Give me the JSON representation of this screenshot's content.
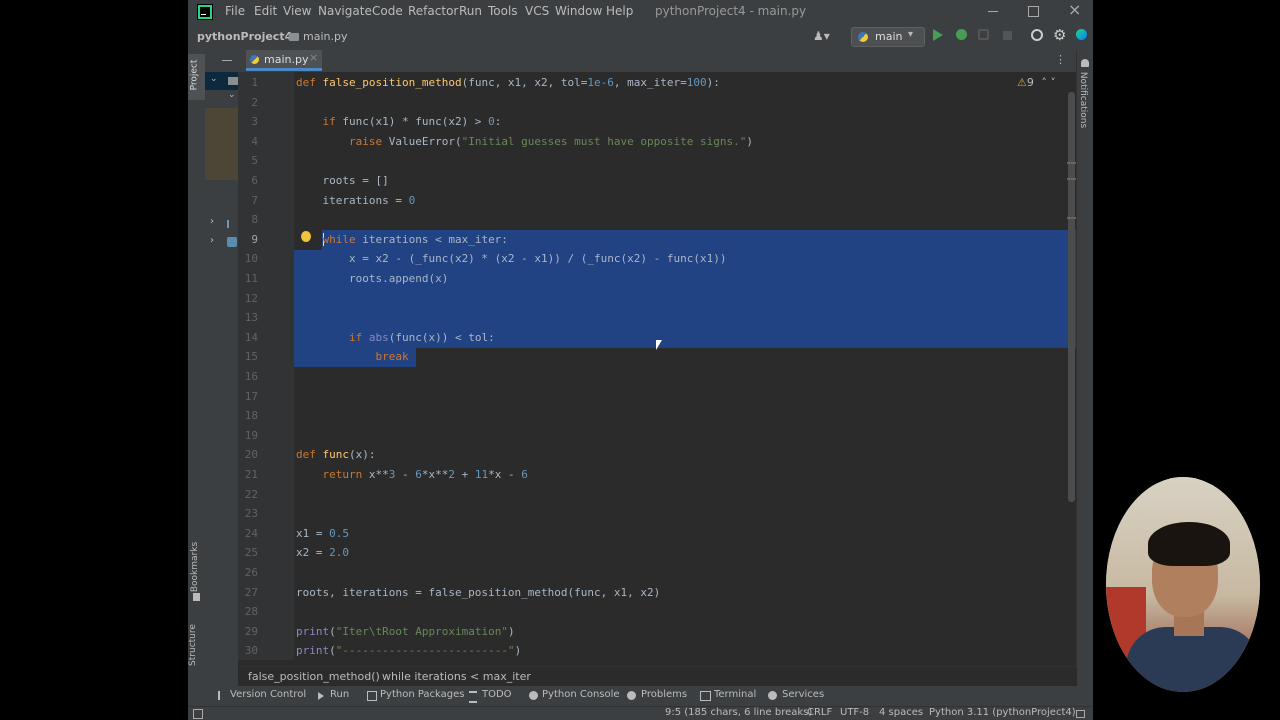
{
  "window": {
    "title": "pythonProject4 - main.py",
    "menu": [
      "File",
      "Edit",
      "View",
      "Navigate",
      "Code",
      "Refactor",
      "Run",
      "Tools",
      "VCS",
      "Window",
      "Help"
    ]
  },
  "nav": {
    "project": "pythonProject4",
    "file": "main.py",
    "run_config": "main"
  },
  "tab": {
    "label": "main.py"
  },
  "inspection": {
    "count": "9"
  },
  "side_tools": {
    "project": "Project",
    "bookmarks": "Bookmarks",
    "structure": "Structure",
    "notifications": "Notifications"
  },
  "code": {
    "line_numbers": [
      "1",
      "2",
      "3",
      "4",
      "5",
      "6",
      "7",
      "8",
      "9",
      "10",
      "11",
      "12",
      "13",
      "14",
      "15",
      "16",
      "17",
      "18",
      "19",
      "20",
      "21",
      "22",
      "23",
      "24",
      "25",
      "26",
      "27",
      "28",
      "29",
      "30"
    ],
    "lines": [
      [
        {
          "t": "def ",
          "c": "#cc7832"
        },
        {
          "t": "false_position_method",
          "c": "#ffc66d"
        },
        {
          "t": "(func, x1, x2, tol=",
          "c": "#a9b7c6"
        },
        {
          "t": "1e-6",
          "c": "#6897bb"
        },
        {
          "t": ", max_iter=",
          "c": "#a9b7c6"
        },
        {
          "t": "100",
          "c": "#6897bb"
        },
        {
          "t": "):",
          "c": "#a9b7c6"
        }
      ],
      [],
      [
        {
          "t": "    if ",
          "c": "#cc7832"
        },
        {
          "t": "func(x1) * func(x2) > ",
          "c": "#a9b7c6"
        },
        {
          "t": "0",
          "c": "#6897bb"
        },
        {
          "t": ":",
          "c": "#a9b7c6"
        }
      ],
      [
        {
          "t": "        raise ",
          "c": "#cc7832"
        },
        {
          "t": "ValueError(",
          "c": "#a9b7c6"
        },
        {
          "t": "\"Initial guesses must have opposite signs.\"",
          "c": "#6a8759"
        },
        {
          "t": ")",
          "c": "#a9b7c6"
        }
      ],
      [],
      [
        {
          "t": "    roots = []",
          "c": "#a9b7c6"
        }
      ],
      [
        {
          "t": "    iterations = ",
          "c": "#a9b7c6"
        },
        {
          "t": "0",
          "c": "#6897bb"
        }
      ],
      [],
      [
        {
          "t": "    while ",
          "c": "#cc7832"
        },
        {
          "t": "iterations < max_iter:",
          "c": "#a9b7c6"
        }
      ],
      [
        {
          "t": "        x = x2 - (_func(x2) * (x2 - x1)) / (_func(x2) - func(x1))",
          "c": "#a9b7c6"
        }
      ],
      [
        {
          "t": "        roots.append(x)",
          "c": "#a9b7c6"
        }
      ],
      [],
      [],
      [
        {
          "t": "        if ",
          "c": "#cc7832"
        },
        {
          "t": "abs",
          "c": "#8888c6"
        },
        {
          "t": "(func(x)) < tol:",
          "c": "#a9b7c6"
        }
      ],
      [
        {
          "t": "            break",
          "c": "#cc7832"
        }
      ],
      [],
      [],
      [],
      [],
      [
        {
          "t": "def ",
          "c": "#cc7832"
        },
        {
          "t": "func",
          "c": "#ffc66d"
        },
        {
          "t": "(x):",
          "c": "#a9b7c6"
        }
      ],
      [
        {
          "t": "    return ",
          "c": "#cc7832"
        },
        {
          "t": "x**",
          "c": "#a9b7c6"
        },
        {
          "t": "3 ",
          "c": "#6897bb"
        },
        {
          "t": "- ",
          "c": "#a9b7c6"
        },
        {
          "t": "6",
          "c": "#6897bb"
        },
        {
          "t": "*x**",
          "c": "#a9b7c6"
        },
        {
          "t": "2 ",
          "c": "#6897bb"
        },
        {
          "t": "+ ",
          "c": "#a9b7c6"
        },
        {
          "t": "11",
          "c": "#6897bb"
        },
        {
          "t": "*x - ",
          "c": "#a9b7c6"
        },
        {
          "t": "6",
          "c": "#6897bb"
        }
      ],
      [],
      [],
      [
        {
          "t": "x1 = ",
          "c": "#a9b7c6"
        },
        {
          "t": "0.5",
          "c": "#6897bb"
        }
      ],
      [
        {
          "t": "x2 = ",
          "c": "#a9b7c6"
        },
        {
          "t": "2.0",
          "c": "#6897bb"
        }
      ],
      [],
      [
        {
          "t": "roots, iterations = false_position_method(func, x1, x2)",
          "c": "#a9b7c6"
        }
      ],
      [],
      [
        {
          "t": "print",
          "c": "#8888c6"
        },
        {
          "t": "(",
          "c": "#a9b7c6"
        },
        {
          "t": "\"Iter\\tRoot Approximation\"",
          "c": "#6a8759"
        },
        {
          "t": ")",
          "c": "#a9b7c6"
        }
      ],
      [
        {
          "t": "print",
          "c": "#8888c6"
        },
        {
          "t": "(",
          "c": "#a9b7c6"
        },
        {
          "t": "\"-------------------------\"",
          "c": "#6a8759"
        },
        {
          "t": ")",
          "c": "#a9b7c6"
        }
      ]
    ]
  },
  "breadcrumbs": {
    "fn": "false_position_method()",
    "stmt": "while iterations < max_iter"
  },
  "tool_windows": [
    "Version Control",
    "Run",
    "Python Packages",
    "TODO",
    "Python Console",
    "Problems",
    "Terminal",
    "Services"
  ],
  "status": {
    "position": "9:5 (185 chars, 6 line breaks)",
    "line_sep": "CRLF",
    "encoding": "UTF-8",
    "indent": "4 spaces",
    "interpreter": "Python 3.11 (pythonProject4)"
  },
  "colors": {
    "selection": "#214283",
    "editor_bg": "#2b2b2b",
    "chrome_bg": "#3c3f41"
  }
}
